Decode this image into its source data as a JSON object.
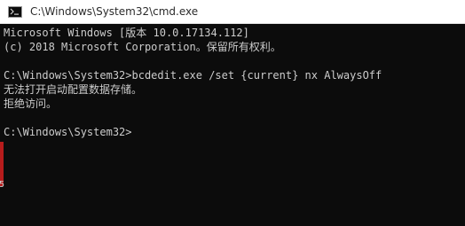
{
  "window": {
    "title": "C:\\Windows\\System32\\cmd.exe",
    "icon": "command-prompt-icon"
  },
  "console": {
    "lines": [
      "Microsoft Windows [版本 10.0.17134.112]",
      "(c) 2018 Microsoft Corporation。保留所有权利。",
      "",
      "C:\\Windows\\System32>bcdedit.exe /set {current} nx AlwaysOff",
      "无法打开启动配置数据存储。",
      "拒绝访问。",
      "",
      "C:\\Windows\\System32>"
    ]
  },
  "edge_glyph": "5",
  "colors": {
    "console_background": "#0c0c0c",
    "console_text": "#cccccc",
    "titlebar_background": "#ffffff"
  }
}
